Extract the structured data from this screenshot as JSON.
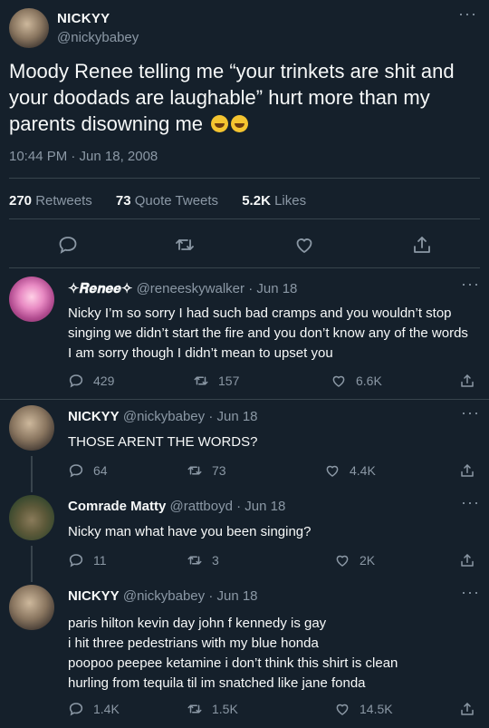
{
  "main": {
    "name": "NICKYY",
    "handle": "@nickybabey",
    "text": "Moody Renee telling me “your trinkets are shit and your doodads are laughable” hurt more than my parents disowning me",
    "emojis": [
      "loudly-crying-face",
      "loudly-crying-face"
    ],
    "time": "10:44 PM · Jun 18, 2008",
    "stats": {
      "retweets": "270",
      "retweets_label": "Retweets",
      "quotes": "73",
      "quotes_label": "Quote Tweets",
      "likes": "5.2K",
      "likes_label": "Likes"
    },
    "actions": [
      "reply-icon",
      "retweet-icon",
      "like-icon",
      "share-icon"
    ]
  },
  "replies": [
    {
      "name": "✧𝑹𝒆𝒏𝒆𝒆✧",
      "handle": "@reneeskywalker",
      "date": "· Jun 18",
      "text": "Nicky I’m so sorry I had such bad cramps and you wouldn’t stop singing we didn’t start the fire and you don’t know any of the words I am sorry though I didn’t mean to upset you",
      "replies": "429",
      "retweets": "157",
      "likes": "6.6K"
    },
    {
      "name": "NICKYY",
      "handle": "@nickybabey",
      "date": "· Jun 18",
      "text": "THOSE ARENT THE WORDS?",
      "replies": "64",
      "retweets": "73",
      "likes": "4.4K"
    },
    {
      "name": "Comrade Matty",
      "handle": "@rattboyd",
      "date": "· Jun 18",
      "text": "Nicky man what have you been singing?",
      "replies": "11",
      "retweets": "3",
      "likes": "2K"
    },
    {
      "name": "NICKYY",
      "handle": "@nickybabey",
      "date": "· Jun 18",
      "lines": [
        "paris hilton kevin day john f kennedy is gay",
        "i hit three pedestrians with my blue honda",
        "poopoo peepee ketamine i don’t think this shirt is clean",
        "hurling from tequila til im snatched like jane fonda"
      ],
      "replies": "1.4K",
      "retweets": "1.5K",
      "likes": "14.5K"
    }
  ],
  "colors": {
    "background": "#15202b",
    "text": "#f7f9f9",
    "muted": "#8b98a5",
    "divider": "#38444d"
  }
}
